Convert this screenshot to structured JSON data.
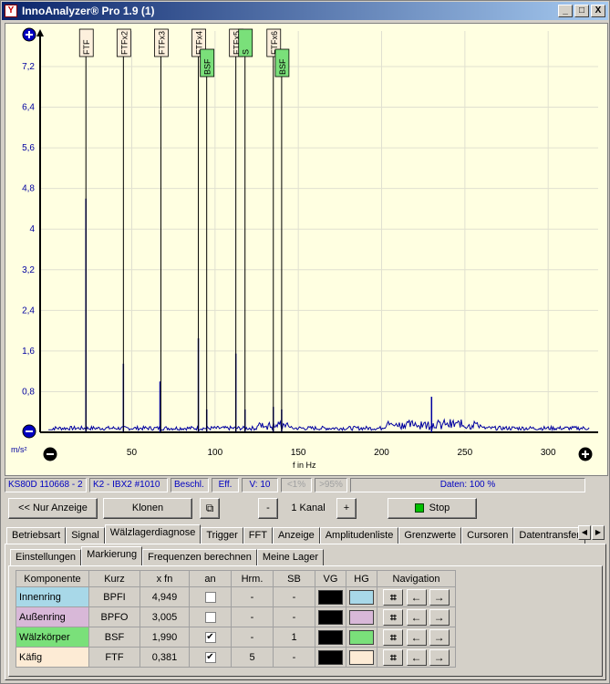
{
  "window": {
    "title": "InnoAnalyzer® Pro 1.9 (1)",
    "min": "_",
    "max": "□",
    "close": "X"
  },
  "chart_data": {
    "type": "line",
    "xlabel": "f in Hz",
    "ylabel": "m/s²",
    "xlim": [
      -5,
      330
    ],
    "ylim": [
      0,
      7.9
    ],
    "x_ticks": [
      "50",
      "100",
      "150",
      "200",
      "250",
      "300"
    ],
    "y_ticks": [
      "0,8",
      "1,6",
      "2,4",
      "3,2",
      "4",
      "4,8",
      "5,6",
      "6,4",
      "7,2"
    ],
    "peaks": [
      {
        "x": 22.5,
        "y": 4.6
      },
      {
        "x": 45,
        "y": 1.35
      },
      {
        "x": 67,
        "y": 1.0
      },
      {
        "x": 90,
        "y": 1.85
      },
      {
        "x": 95,
        "y": 0.45
      },
      {
        "x": 112.5,
        "y": 1.55
      },
      {
        "x": 118,
        "y": 0.45
      },
      {
        "x": 135,
        "y": 0.5
      },
      {
        "x": 140,
        "y": 0.45
      },
      {
        "x": 230,
        "y": 0.7
      }
    ],
    "markers": [
      {
        "label": "FTF",
        "x": 22.5,
        "row": 0,
        "color": "#fdf0dd"
      },
      {
        "label": "FTFx2",
        "x": 45,
        "row": 0,
        "color": "#fdf0dd"
      },
      {
        "label": "FTFx3",
        "x": 67.5,
        "row": 0,
        "color": "#fdf0dd"
      },
      {
        "label": "FTFx4",
        "x": 90,
        "row": 0,
        "color": "#fdf0dd"
      },
      {
        "label": "BSF",
        "x": 95,
        "row": 1,
        "color": "#7ae07a"
      },
      {
        "label": "FTFx5",
        "x": 112.5,
        "row": 0,
        "color": "#fdf0dd"
      },
      {
        "label": "S",
        "x": 118,
        "row": 0,
        "color": "#7ae07a"
      },
      {
        "label": "FTFx6",
        "x": 135,
        "row": 0,
        "color": "#fdf0dd"
      },
      {
        "label": "BSF",
        "x": 140,
        "row": 1,
        "color": "#7ae07a"
      }
    ]
  },
  "status": {
    "device": "KS80D 110668 - 2",
    "channel": "K2 - IBX2 #1010",
    "beschl": "Beschl.",
    "eff": "Eff.",
    "v": "V: 10",
    "lt1": "<1%",
    "gt95": ">95%",
    "daten": "Daten: 100 %"
  },
  "toolbar": {
    "nur_anzeige": "<< Nur Anzeige",
    "klonen": "Klonen",
    "minus": "-",
    "kanal": "1 Kanal",
    "plus": "+",
    "stop": "Stop"
  },
  "main_tabs": [
    "Betriebsart",
    "Signal",
    "Wälzlagerdiagnose",
    "Trigger",
    "FFT",
    "Anzeige",
    "Amplitudenliste",
    "Grenzwerte",
    "Cursoren",
    "Datentransfer"
  ],
  "sub_tabs": [
    "Einstellungen",
    "Markierung",
    "Frequenzen berechnen",
    "Meine Lager"
  ],
  "table": {
    "headers": [
      "Komponente",
      "Kurz",
      "x fn",
      "an",
      "Hrm.",
      "SB",
      "VG",
      "HG",
      "Navigation"
    ],
    "rows": [
      {
        "name": "Innenring",
        "kurz": "BPFI",
        "xfn": "4,949",
        "an": "",
        "hrm": "-",
        "sb": "-",
        "vg": "#000000",
        "hg": "#a8d8e8",
        "bg": "#a8d8e8"
      },
      {
        "name": "Außenring",
        "kurz": "BPFO",
        "xfn": "3,005",
        "an": "",
        "hrm": "-",
        "sb": "-",
        "vg": "#000000",
        "hg": "#d8b8d8",
        "bg": "#d8b8d8"
      },
      {
        "name": "Wälzkörper",
        "kurz": "BSF",
        "xfn": "1,990",
        "an": "✔",
        "hrm": "-",
        "sb": "1",
        "vg": "#000000",
        "hg": "#7ae07a",
        "bg": "#7ae07a"
      },
      {
        "name": "Käfig",
        "kurz": "FTF",
        "xfn": "0,381",
        "an": "✔",
        "hrm": "5",
        "sb": "-",
        "vg": "#000000",
        "hg": "#fdebd5",
        "bg": "#fdebd5"
      }
    ]
  }
}
